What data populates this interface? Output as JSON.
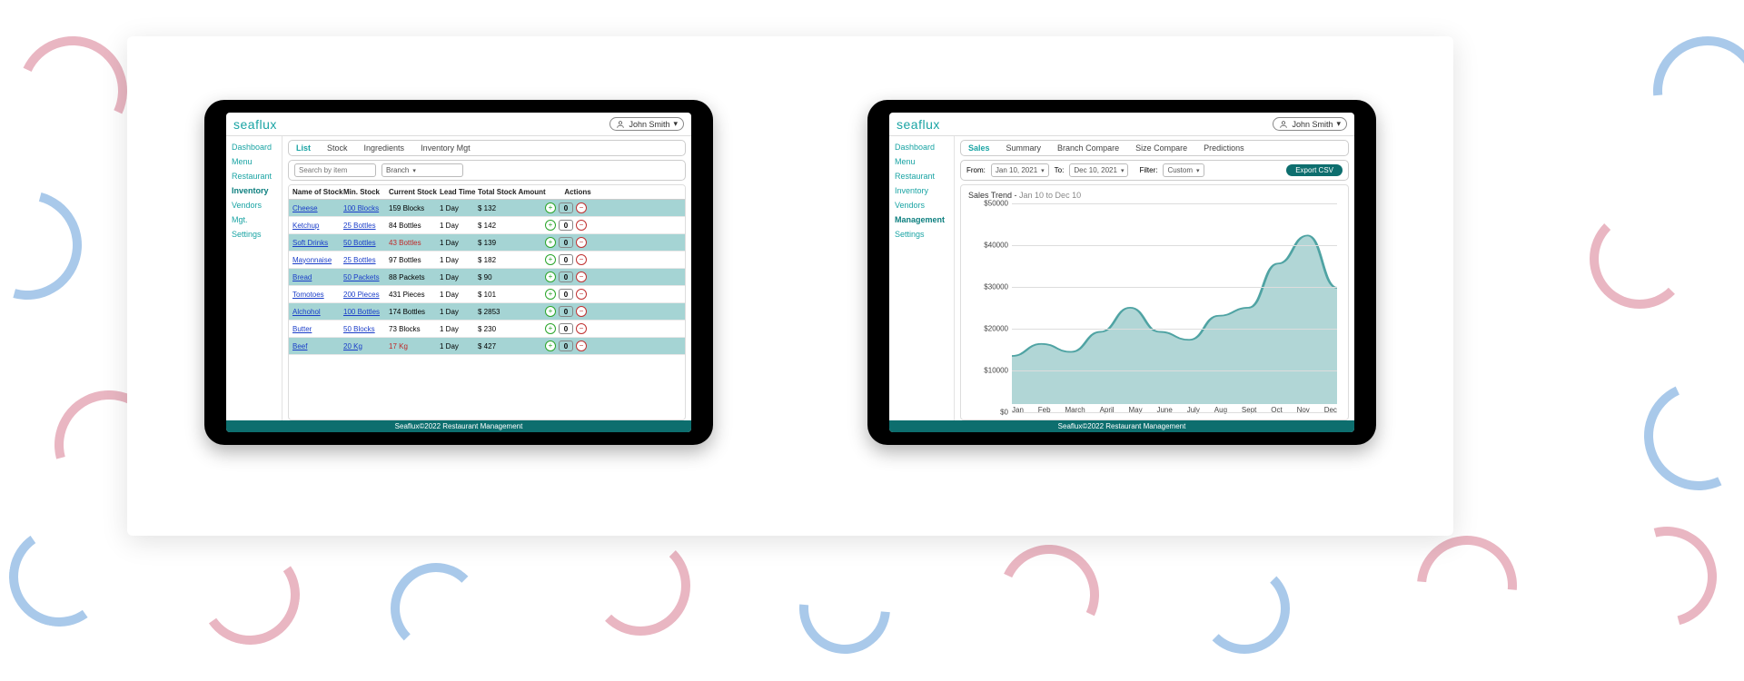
{
  "brand": "seaflux",
  "user": "John Smith",
  "footer": "Seaflux©2022 Restaurant Management",
  "left": {
    "nav": [
      "Dashboard",
      "Menu",
      "Restaurant",
      "Inventory",
      "Vendors",
      "Mgt.",
      "Settings"
    ],
    "nav_active": 3,
    "tabs": [
      "List",
      "Stock",
      "Ingredients",
      "Inventory Mgt"
    ],
    "tab_active": 0,
    "search_placeholder": "Search by item",
    "branch_label": "Branch",
    "columns": [
      "Name of Stock",
      "Min. Stock",
      "Current Stock",
      "Lead Time",
      "Total Stock Amount",
      "Actions"
    ],
    "rows": [
      {
        "name": "Cheese",
        "min": "100 Blocks",
        "cur": "159 Blocks",
        "lead": "1 Day",
        "amt": "$ 132",
        "qty": "0",
        "low": false
      },
      {
        "name": "Ketchup",
        "min": "25 Bottles",
        "cur": "84 Bottles",
        "lead": "1 Day",
        "amt": "$ 142",
        "qty": "0",
        "low": false
      },
      {
        "name": "Soft Drinks",
        "min": "50 Bottles",
        "cur": "43 Bottles",
        "lead": "1 Day",
        "amt": "$ 139",
        "qty": "0",
        "low": true
      },
      {
        "name": "Mayonnaise",
        "min": "25 Bottles",
        "cur": "97 Bottles",
        "lead": "1 Day",
        "amt": "$ 182",
        "qty": "0",
        "low": false
      },
      {
        "name": "Bread",
        "min": "50 Packets",
        "cur": "88 Packets",
        "lead": "1 Day",
        "amt": "$ 90",
        "qty": "0",
        "low": false
      },
      {
        "name": "Tomotoes",
        "min": "200 Pieces",
        "cur": "431 Pieces",
        "lead": "1 Day",
        "amt": "$ 101",
        "qty": "0",
        "low": false
      },
      {
        "name": "Alchohol",
        "min": "100 Bottles",
        "cur": "174 Bottles",
        "lead": "1 Day",
        "amt": "$ 2853",
        "qty": "0",
        "low": false
      },
      {
        "name": "Butter",
        "min": "50 Blocks",
        "cur": "73 Blocks",
        "lead": "1 Day",
        "amt": "$ 230",
        "qty": "0",
        "low": false
      },
      {
        "name": "Beef",
        "min": "20 Kg",
        "cur": "17 Kg",
        "lead": "1 Day",
        "amt": "$ 427",
        "qty": "0",
        "low": true
      }
    ]
  },
  "right": {
    "nav": [
      "Dashboard",
      "Menu",
      "Restaurant",
      "Inventory",
      "Vendors",
      "Management",
      "Settings"
    ],
    "nav_active": 5,
    "tabs": [
      "Sales",
      "Summary",
      "Branch Compare",
      "Size Compare",
      "Predictions"
    ],
    "tab_active": 0,
    "from_label": "From:",
    "from_value": "Jan 10, 2021",
    "to_label": "To:",
    "to_value": "Dec 10, 2021",
    "filter_label": "Filter:",
    "filter_value": "Custom",
    "export": "Export CSV",
    "chart_heading": "Sales Trend - ",
    "chart_sub": "Jan 10 to Dec 10"
  },
  "chart_data": {
    "type": "area",
    "title": "Sales Trend - Jan 10 to Dec 10",
    "xlabel": "",
    "ylabel": "",
    "ylim": [
      0,
      50000
    ],
    "yticks": [
      "$0",
      "$10000",
      "$20000",
      "$30000",
      "$40000",
      "$50000"
    ],
    "categories": [
      "Jan",
      "Feb",
      "March",
      "April",
      "May",
      "June",
      "July",
      "Aug",
      "Sept",
      "Oct",
      "Nov",
      "Dec"
    ],
    "values": [
      12000,
      15000,
      13000,
      18000,
      24000,
      18000,
      16000,
      22000,
      24000,
      35000,
      42000,
      29000
    ]
  }
}
